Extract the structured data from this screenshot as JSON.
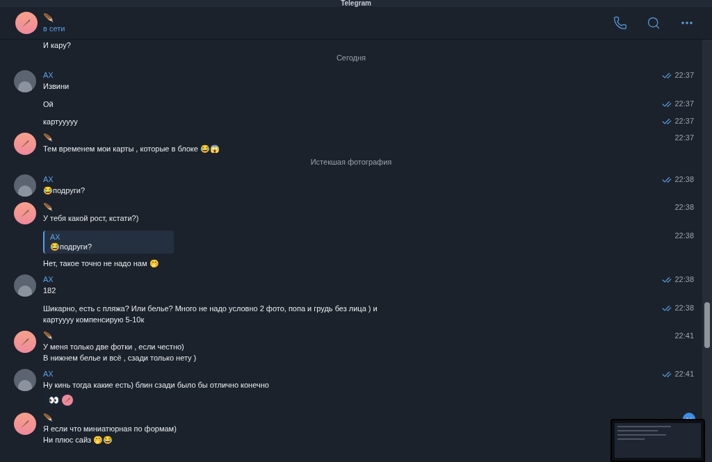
{
  "window": {
    "title": "Telegram"
  },
  "chat": {
    "name": "🪶",
    "status": "в сети"
  },
  "messages": [
    {
      "kind": "message",
      "text": "И кару?"
    },
    {
      "kind": "service",
      "text": "Сегодня"
    },
    {
      "kind": "message",
      "avatar": {
        "kind": "photo"
      },
      "name": "AX",
      "text": "Извини",
      "time": "22:37",
      "read": true
    },
    {
      "kind": "message",
      "text": "Ой",
      "time": "22:37",
      "read": true
    },
    {
      "kind": "message",
      "text": "картууууу",
      "time": "22:37",
      "read": true
    },
    {
      "kind": "message",
      "avatar": {
        "kind": "feather"
      },
      "name": "🪶",
      "text": "Тем временем мои карты , которые в блоке 😂😱",
      "time": "22:37"
    },
    {
      "kind": "service",
      "text": "Истекшая фотография"
    },
    {
      "kind": "message",
      "avatar": {
        "kind": "photo"
      },
      "name": "AX",
      "text": "😂подруги?",
      "time": "22:38",
      "read": true
    },
    {
      "kind": "message",
      "avatar": {
        "kind": "feather"
      },
      "name": "🪶",
      "text": "У тебя какой рост, кстати?)",
      "time": "22:38"
    },
    {
      "kind": "message",
      "reply": {
        "name": "AX",
        "text": "😂подруги?"
      },
      "text": "Нет, такое точно не надо нам 🤭",
      "time": "22:38"
    },
    {
      "kind": "message",
      "avatar": {
        "kind": "photo"
      },
      "name": "AX",
      "text": "182",
      "time": "22:38",
      "read": true
    },
    {
      "kind": "message",
      "text": "Шикарно, есть с пляжа? Или белье? Много не надо условно 2 фото, попа и грудь без лица ) и\nкартуууу компенсирую 5-10к",
      "time": "22:38",
      "read": true
    },
    {
      "kind": "message",
      "avatar": {
        "kind": "feather"
      },
      "name": "🪶",
      "text": "У меня только две фотки , если честно)\nВ нижнем белье и всё , сзади только нету )",
      "time": "22:41"
    },
    {
      "kind": "message",
      "avatar": {
        "kind": "photo"
      },
      "name": "AX",
      "text": "Ну кинь тогда какие есть) блин сзади было бы отлично конечно",
      "time": "22:41",
      "read": true,
      "reaction": "👀"
    },
    {
      "kind": "message",
      "avatar": {
        "kind": "feather"
      },
      "name": "🪶",
      "text": "Я если что миниатюрная по формам)\nНи плюс сайз 🤭😂"
    }
  ]
}
